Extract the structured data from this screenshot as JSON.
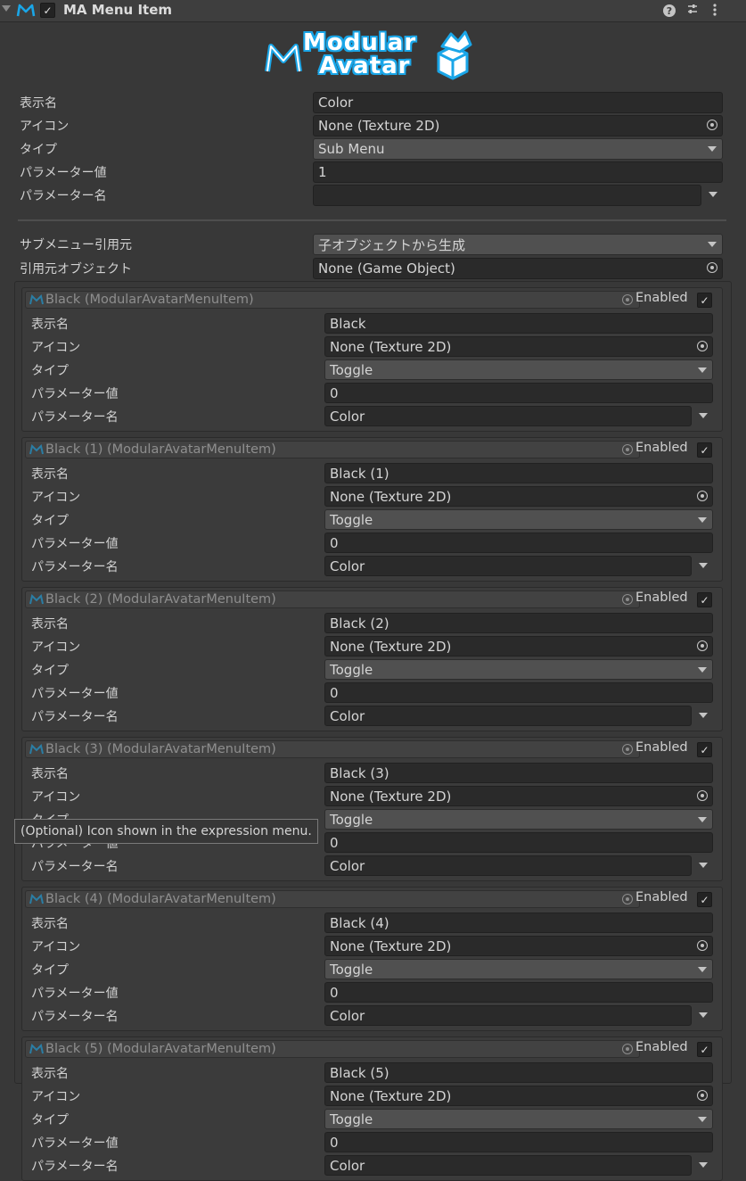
{
  "component": {
    "title": "MA Menu Item",
    "checked": true,
    "header_icons": [
      "help-icon",
      "settings-sliders-icon",
      "more-options-icon"
    ]
  },
  "logo": {
    "line1": "Modular",
    "line2": "Avatar",
    "brand_color": "#1aa6e8"
  },
  "fields": {
    "display_name": {
      "label": "表示名",
      "value": "Color"
    },
    "icon": {
      "label": "アイコン",
      "value": "None (Texture 2D)"
    },
    "type": {
      "label": "タイプ",
      "value": "Sub Menu"
    },
    "param_value": {
      "label": "パラメーター値",
      "value": "1"
    },
    "param_name": {
      "label": "パラメーター名",
      "value": ""
    },
    "submenu_source": {
      "label": "サブメニュー引用元",
      "value": "子オブジェクトから生成"
    },
    "source_object": {
      "label": "引用元オブジェクト",
      "value": "None (Game Object)"
    }
  },
  "child_labels": {
    "display_name": "表示名",
    "icon": "アイコン",
    "type": "タイプ",
    "param_value": "パラメーター値",
    "param_name": "パラメーター名",
    "enabled": "Enabled"
  },
  "children": [
    {
      "object": "Black (ModularAvatarMenuItem)",
      "display_name": "Black",
      "icon": "None (Texture 2D)",
      "type": "Toggle",
      "param_value": "0",
      "param_name": "Color",
      "enabled": true
    },
    {
      "object": "Black (1) (ModularAvatarMenuItem)",
      "display_name": "Black (1)",
      "icon": "None (Texture 2D)",
      "type": "Toggle",
      "param_value": "0",
      "param_name": "Color",
      "enabled": true
    },
    {
      "object": "Black (2) (ModularAvatarMenuItem)",
      "display_name": "Black (2)",
      "icon": "None (Texture 2D)",
      "type": "Toggle",
      "param_value": "0",
      "param_name": "Color",
      "enabled": true
    },
    {
      "object": "Black (3) (ModularAvatarMenuItem)",
      "display_name": "Black (3)",
      "icon": "None (Texture 2D)",
      "type": "Toggle",
      "param_value": "0",
      "param_name": "Color",
      "enabled": true
    },
    {
      "object": "Black (4) (ModularAvatarMenuItem)",
      "display_name": "Black (4)",
      "icon": "None (Texture 2D)",
      "type": "Toggle",
      "param_value": "0",
      "param_name": "Color",
      "enabled": true
    },
    {
      "object": "Black (5) (ModularAvatarMenuItem)",
      "display_name": "Black (5)",
      "icon": "None (Texture 2D)",
      "type": "Toggle",
      "param_value": "0",
      "param_name": "Color",
      "enabled": true
    }
  ],
  "tooltip": {
    "text": "(Optional) Icon shown in the expression menu."
  }
}
